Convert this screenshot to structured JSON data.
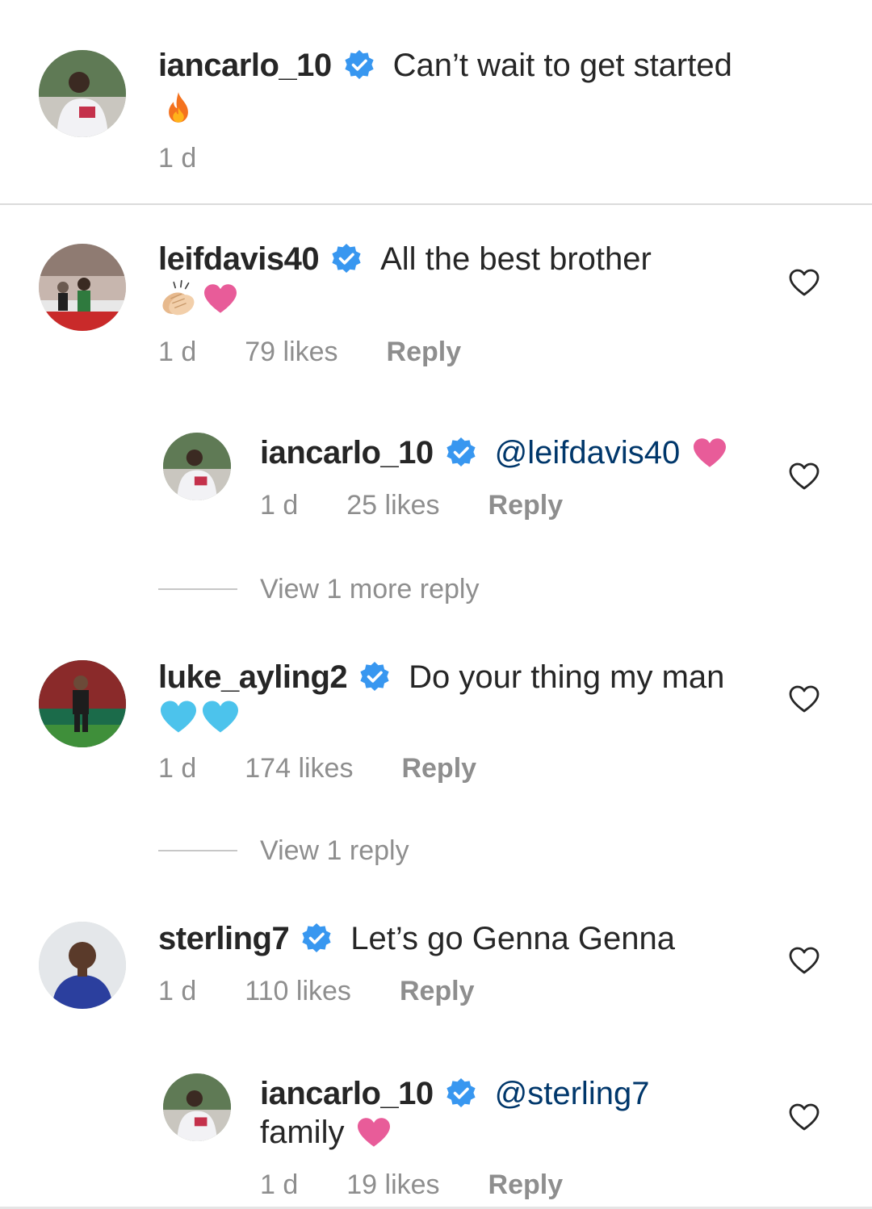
{
  "colors": {
    "verified": "#3897f0",
    "heart_pink": "#e85c99",
    "heart_blue": "#4cc3ec",
    "muted": "#8e8e8e"
  },
  "comments": [
    {
      "username": "iancarlo_10",
      "text": "Can’t wait to get started",
      "emoji": "fire",
      "time": "1 d"
    },
    {
      "username": "leifdavis40",
      "text": "All the best brother",
      "emoji": "clapping-hands + pink-heart",
      "time": "1 d",
      "likes": "79 likes",
      "reply_label": "Reply",
      "replies": [
        {
          "username": "iancarlo_10",
          "mention": "@leifdavis40",
          "emoji": "pink-heart",
          "time": "1 d",
          "likes": "25 likes",
          "reply_label": "Reply"
        }
      ],
      "view_more": "View 1 more reply"
    },
    {
      "username": "luke_ayling2",
      "text": "Do your thing my man",
      "emoji": "blue-heart x2",
      "time": "1 d",
      "likes": "174 likes",
      "reply_label": "Reply",
      "view_more": "View 1 reply"
    },
    {
      "username": "sterling7",
      "text": "Let’s go Genna Genna",
      "time": "1 d",
      "likes": "110 likes",
      "reply_label": "Reply",
      "replies": [
        {
          "username": "iancarlo_10",
          "mention": "@sterling7",
          "text": "family",
          "emoji": "pink-heart",
          "time": "1 d",
          "likes": "19 likes",
          "reply_label": "Reply"
        }
      ]
    }
  ]
}
